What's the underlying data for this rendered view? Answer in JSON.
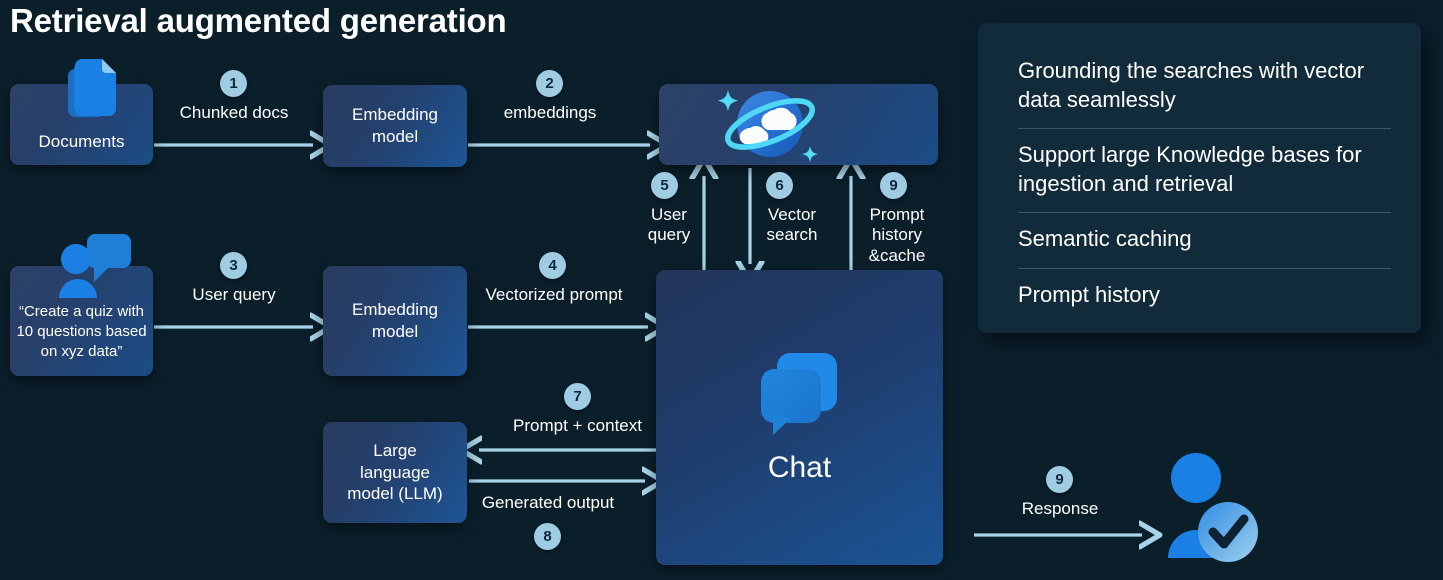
{
  "page": {
    "title": "Retrieval augmented generation",
    "background_color": "#0b1f2b",
    "accent_color": "#9fcce3",
    "arrow_color": "#a8d3e8"
  },
  "nodes": {
    "documents": {
      "label": "Documents",
      "icon": "documents-icon"
    },
    "embedding_model_top": {
      "label": "Embedding\nmodel",
      "line1": "Embedding",
      "line2": "model"
    },
    "cosmos_db": {
      "label": "",
      "icon": "cosmos-db-planet-icon"
    },
    "user_prompt": {
      "label": "“Create a quiz with 10 questions based on xyz data”",
      "icon": "user-chat-icon"
    },
    "embedding_model_bottom": {
      "line1": "Embedding",
      "line2": "model"
    },
    "chat": {
      "label": "Chat",
      "icon": "chat-bubbles-icon"
    },
    "llm": {
      "line1": "Large",
      "line2": "language",
      "line3": "model (LLM)"
    },
    "response_user": {
      "icon": "user-verified-icon"
    }
  },
  "edges": [
    {
      "id": "chunked-docs",
      "step": "1",
      "label": "Chunked docs",
      "direction": "right"
    },
    {
      "id": "embeddings",
      "step": "2",
      "label": "embeddings",
      "direction": "right"
    },
    {
      "id": "user-query-in",
      "step": "3",
      "label": "User query",
      "direction": "right"
    },
    {
      "id": "vectorized-prompt",
      "step": "4",
      "label": "Vectorized prompt",
      "direction": "right"
    },
    {
      "id": "user-query-up",
      "step": "5",
      "label": "User\nquery",
      "line1": "User",
      "line2": "query",
      "direction": "up"
    },
    {
      "id": "vector-search",
      "step": "6",
      "label": "Vector\nsearch",
      "line1": "Vector",
      "line2": "search",
      "direction": "down"
    },
    {
      "id": "prompt-context",
      "step": "7",
      "label": "Prompt + context",
      "direction": "left"
    },
    {
      "id": "generated-output",
      "step": "8",
      "label": "Generated output",
      "direction": "right"
    },
    {
      "id": "prompt-history-cache",
      "step": "9",
      "label": "Prompt history &cache",
      "line1": "Prompt",
      "line2": "history",
      "line3": "&cache",
      "direction": "up"
    },
    {
      "id": "response",
      "step": "9",
      "label": "Response",
      "direction": "right"
    }
  ],
  "info_panel": {
    "items": [
      "Grounding the searches with vector data seamlessly",
      "Support large Knowledge bases for ingestion and retrieval",
      "Semantic caching",
      "Prompt history"
    ]
  }
}
